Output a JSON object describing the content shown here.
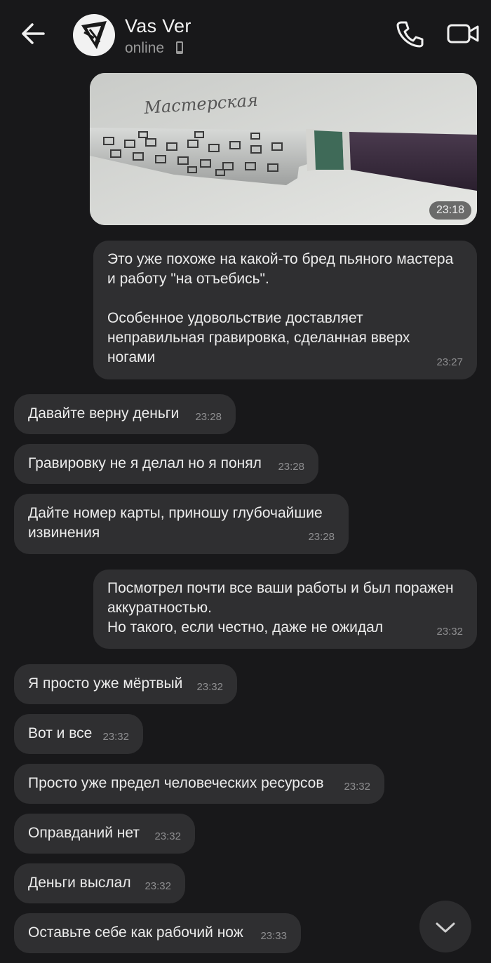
{
  "header": {
    "name": "Vas Ver",
    "status": "online",
    "icons": [
      "arrow-left-icon",
      "phone-icon",
      "video-camera-icon",
      "mobile-device-icon"
    ]
  },
  "photo": {
    "time": "23:18",
    "handwriting": "Мастерская"
  },
  "messages": [
    {
      "side": "out",
      "text": "Это уже похоже на какой-то бред пьяного мастера\nи работу \"на отъебись\".\n\nОсобенное удовольствие доставляет\nнеправильная гравировка, сделанная вверх\nногами",
      "time": "23:27"
    },
    {
      "side": "in",
      "text": "Давайте верну деньги",
      "time": "23:28"
    },
    {
      "side": "in",
      "text": "Гравировку не я делал но я понял",
      "time": "23:28"
    },
    {
      "side": "in",
      "text": "Дайте номер карты, приношу глубочайшие\nизвинения",
      "time": "23:28"
    },
    {
      "side": "out",
      "text": "Посмотрел почти все ваши работы и был поражен\nаккуратностью.\nНо такого, если честно, даже не ожидал",
      "time": "23:32"
    },
    {
      "side": "in",
      "text": "Я просто уже мёртвый",
      "time": "23:32"
    },
    {
      "side": "in",
      "text": "Вот и все",
      "time": "23:32"
    },
    {
      "side": "in",
      "text": "Просто уже предел человеческих ресурсов",
      "time": "23:32"
    },
    {
      "side": "in",
      "text": "Оправданий нет",
      "time": "23:32"
    },
    {
      "side": "in",
      "text": "Деньги выслал",
      "time": "23:32"
    },
    {
      "side": "in",
      "text": "Оставьте себе как рабочий нож",
      "time": "23:33"
    }
  ],
  "colors": {
    "background": "#18181a",
    "bubble": "#2f2f31",
    "text": "#ececec",
    "timestamp": "#8e8e90"
  }
}
